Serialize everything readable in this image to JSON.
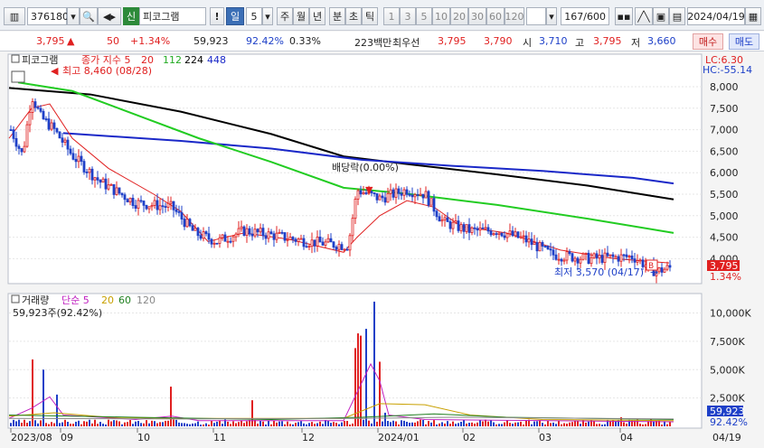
{
  "toolbar": {
    "code": "376180",
    "market_badge": "신",
    "stock_name": "피코그램",
    "alert_label": "!",
    "period_active": "일",
    "period_count": "5",
    "periods": [
      "주",
      "월",
      "년",
      "분",
      "초",
      "틱"
    ],
    "intervals": [
      "1",
      "3",
      "5",
      "10",
      "20",
      "30",
      "60",
      "120"
    ],
    "page": "167/600",
    "date": "2024/04/19"
  },
  "quote": {
    "price": "3,795",
    "change": "50",
    "change_pct": "+1.34%",
    "volume": "59,923",
    "volume_ratio": "92.42%",
    "turnover": "0.33%",
    "amount": "223백만",
    "best_label": "최우선",
    "ask": "3,795",
    "bid": "3,790",
    "open_label": "시",
    "open": "3,710",
    "high_label": "고",
    "high": "3,795",
    "low_label": "저",
    "low": "3,660",
    "buy_label": "매수",
    "sell_label": "매도"
  },
  "price_panel": {
    "legend_name": "피코그램",
    "legend_main": "종가 지수 5",
    "ma_periods": [
      "20",
      "112",
      "224",
      "448"
    ],
    "lc": "LC:6.30",
    "hc": "HC:-55.14",
    "high_annot": "최고 8,460 (08/28)",
    "low_annot": "최저 3,570 (04/17)",
    "dividend_annot": "배당락(0.00%)",
    "b_marker": "B",
    "last_price": "3,795",
    "last_pct": "1.34%",
    "y_ticks": [
      "8,000",
      "7,500",
      "7,000",
      "6,500",
      "6,000",
      "5,500",
      "5,000",
      "4,500",
      "4,000"
    ]
  },
  "volume_panel": {
    "legend_name": "거래량",
    "legend_main": "단순 5",
    "ma_periods": [
      "20",
      "60",
      "120"
    ],
    "value_line": "59,923주(92.42%)",
    "y_ticks": [
      "10,000K",
      "7,500K",
      "5,000K",
      "2,500K"
    ],
    "last_volume": "59,923",
    "last_pct": "92.42%"
  },
  "x_axis": {
    "labels": [
      "2023/08",
      "09",
      "10",
      "11",
      "12",
      "2024/01",
      "02",
      "03",
      "04"
    ],
    "right_label": "04/19"
  },
  "colors": {
    "up": "#e02020",
    "down": "#1e40c8",
    "ma5": "#e02020",
    "ma20": "#e02020",
    "ma112": "#22cc22",
    "ma224": "#000000",
    "ma448": "#1a28c8"
  }
}
